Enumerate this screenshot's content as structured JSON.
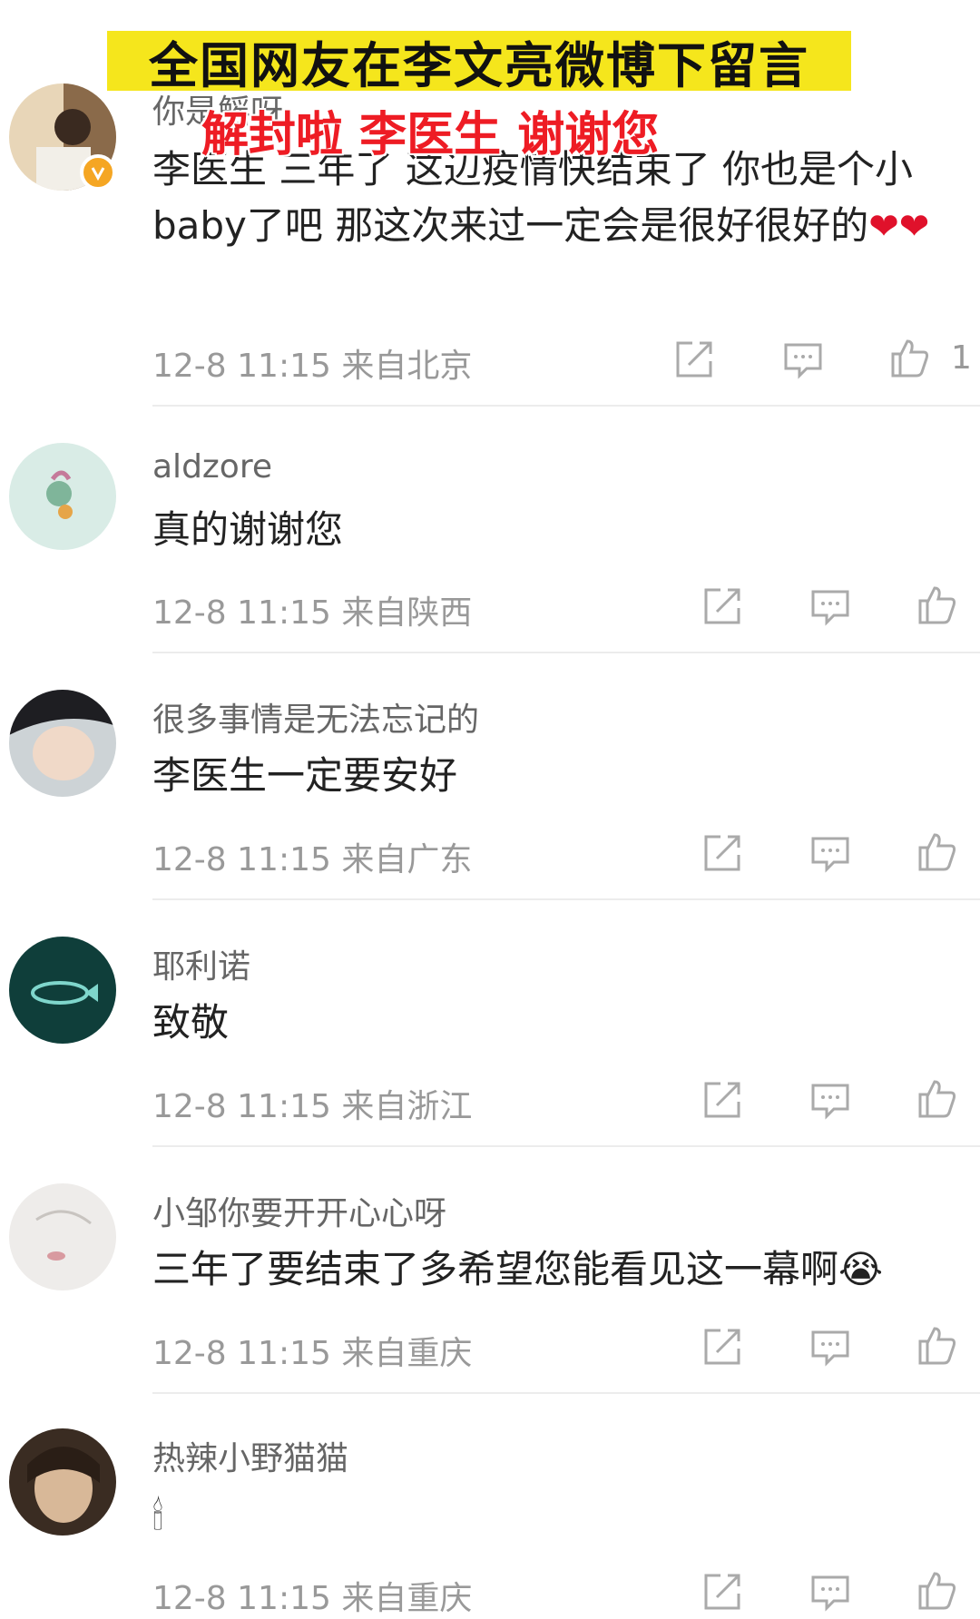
{
  "overlay": {
    "banner_text": "全国网友在李文亮微博下留言",
    "caption_text": "解封啦 李医生 谢谢您"
  },
  "comments": [
    {
      "username": "你是鳐呀",
      "content": "李医生  三年了 这辺疫情快结束了 你也是个小baby了吧   那这次来过一定会是很好很好的",
      "emoji": "❤❤",
      "time": "12-8 11:15",
      "location": "来自北京",
      "likes": "1"
    },
    {
      "username": "aldzore",
      "content": "真的谢谢您",
      "time": "12-8 11:15",
      "location": "来自陕西"
    },
    {
      "username": "很多事情是无法忘记的",
      "content": "李医生一定要安好",
      "time": "12-8 11:15",
      "location": "来自广东"
    },
    {
      "username": "耶利诺",
      "content": "致敬",
      "time": "12-8 11:15",
      "location": "来自浙江"
    },
    {
      "username": "小邹你要开开心心呀",
      "content": "三年了要结束了多希望您能看见这一幕啊",
      "emoji": "😭",
      "time": "12-8 11:15",
      "location": "来自重庆"
    },
    {
      "username": "热辣小野猫猫",
      "content": "🕯",
      "time": "12-8 11:15",
      "location": "来自重庆"
    }
  ],
  "icons": {
    "share": "share-icon",
    "comment": "comment-icon",
    "like": "thumbs-up-icon",
    "verified": "verified-badge-icon"
  },
  "colors": {
    "banner_bg": "#f5e61c",
    "caption_red": "#ee1c24",
    "badge_orange": "#f5a623"
  }
}
